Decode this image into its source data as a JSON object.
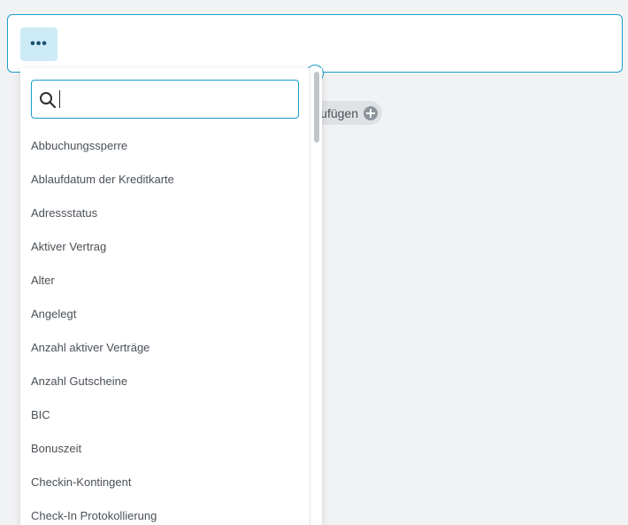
{
  "filter": {
    "more_button_label": "•••",
    "add_chip_label": "ufügen"
  },
  "dropdown": {
    "search": {
      "value": "",
      "placeholder": ""
    },
    "options": [
      "Abbuchungssperre",
      "Ablaufdatum der Kreditkarte",
      "Adressstatus",
      "Aktiver Vertrag",
      "Alter",
      "Angelegt",
      "Anzahl aktiver Verträge",
      "Anzahl Gutscheine",
      "BIC",
      "Bonuszeit",
      "Checkin-Kontingent",
      "Check-In Protokollierung"
    ]
  },
  "colors": {
    "accent": "#1a9dcc",
    "button_bg": "#cdeaf7",
    "page_bg": "#f1f2f4"
  },
  "icons": {
    "more": "more-dots-icon",
    "connector": "connector-circle-icon",
    "add": "plus-circle-icon",
    "search": "search-icon"
  }
}
